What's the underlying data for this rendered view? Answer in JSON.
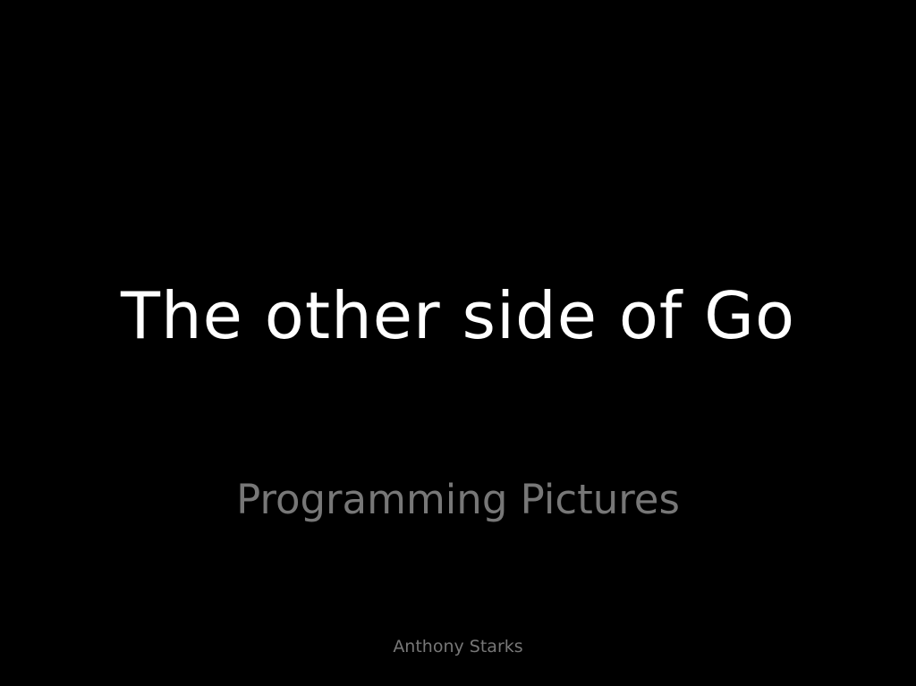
{
  "slide": {
    "title": "The other side of Go",
    "subtitle": "Programming Pictures",
    "author": "Anthony Starks"
  },
  "colors": {
    "background": "#000000",
    "title": "#ffffff",
    "subtitle": "#777777",
    "author": "#777777"
  }
}
